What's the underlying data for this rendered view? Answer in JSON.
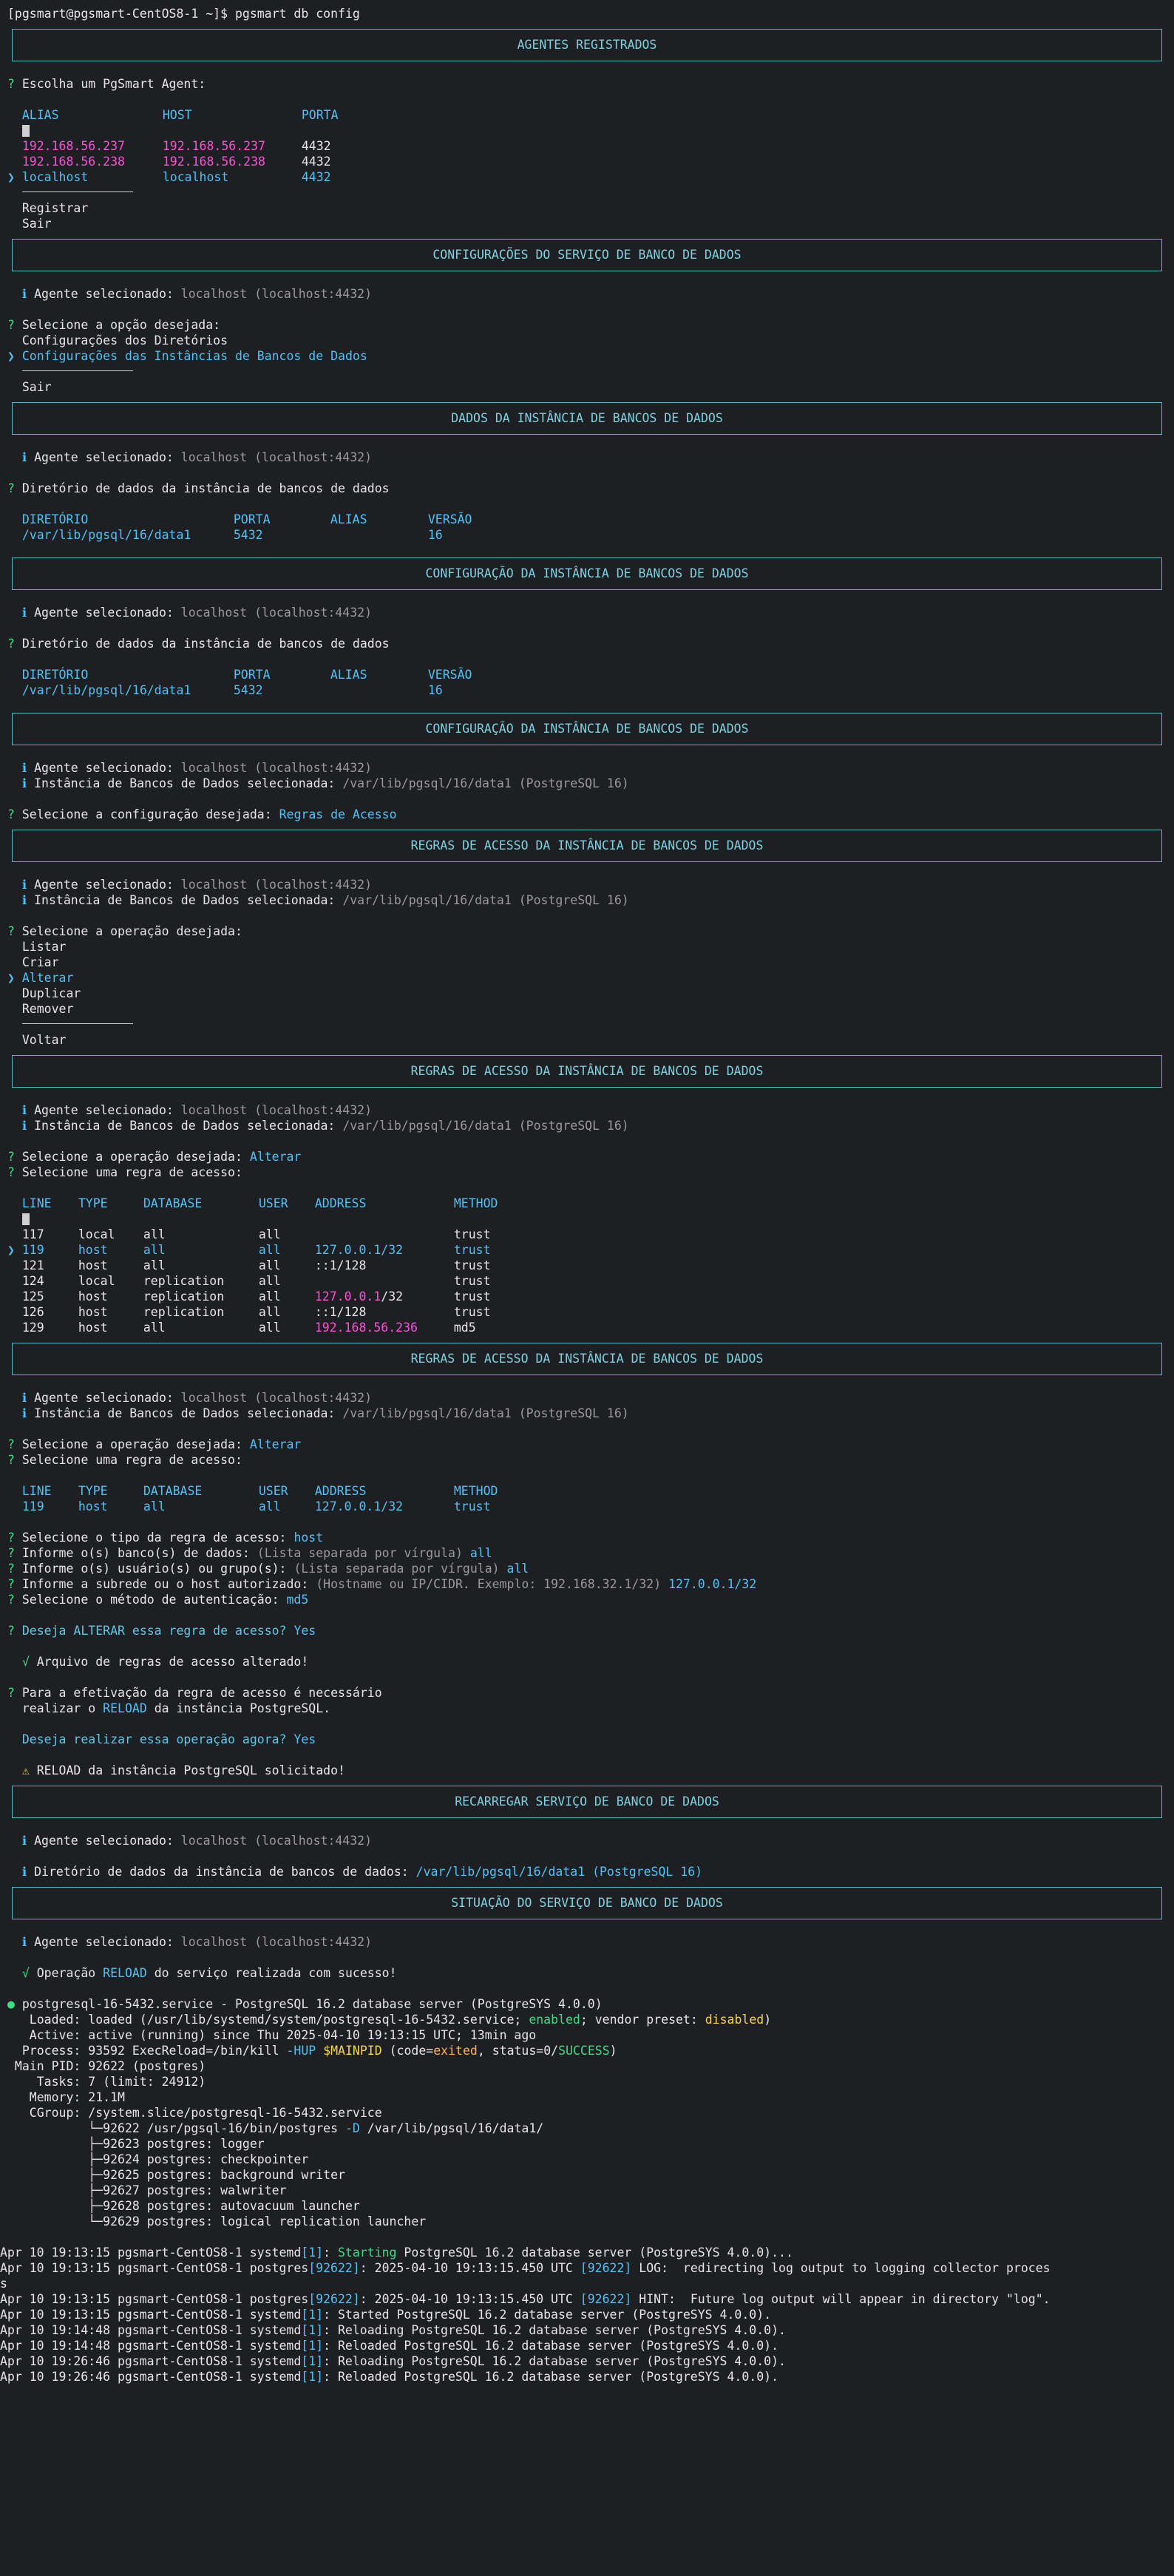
{
  "prompt": "[pgsmart@pgsmart-CentOS8-1 ~]$ pgsmart db config",
  "s1": {
    "header": "AGENTES REGISTRADOS",
    "question": "Escolha um PgSmart Agent:",
    "cols": [
      "ALIAS",
      "HOST",
      "PORTA"
    ],
    "rows": [
      {
        "alias": "192.168.56.237",
        "host": "192.168.56.237",
        "port": "4432"
      },
      {
        "alias": "192.168.56.238",
        "host": "192.168.56.238",
        "port": "4432"
      },
      {
        "alias": "localhost",
        "host": "localhost",
        "port": "4432"
      }
    ],
    "opt1": "Registrar",
    "opt2": "Sair"
  },
  "s2": {
    "header": "CONFIGURAÇÕES DO SERVIÇO DE BANCO DE DADOS",
    "agent_label": "Agente selecionado:",
    "agent_val": "localhost (localhost:4432)",
    "question": "Selecione a opção desejada:",
    "opt1": "Configurações dos Diretórios",
    "opt2": "Configurações das Instâncias de Bancos de Dados",
    "opt3": "Sair"
  },
  "s3": {
    "header": "DADOS DA INSTÂNCIA DE BANCOS DE DADOS",
    "agent_label": "Agente selecionado:",
    "agent_val": "localhost (localhost:4432)",
    "question": "Diretório de dados da instância de bancos de dados",
    "cols": [
      "DIRETÓRIO",
      "PORTA",
      "ALIAS",
      "VERSÃO"
    ],
    "row": {
      "dir": "/var/lib/pgsql/16/data1",
      "port": "5432",
      "alias": "",
      "ver": "16"
    }
  },
  "s4": {
    "header": "CONFIGURAÇÃO DA INSTÂNCIA DE BANCOS DE DADOS",
    "agent_label": "Agente selecionado:",
    "agent_val": "localhost (localhost:4432)",
    "question": "Diretório de dados da instância de bancos de dados",
    "cols": [
      "DIRETÓRIO",
      "PORTA",
      "ALIAS",
      "VERSÃO"
    ],
    "row": {
      "dir": "/var/lib/pgsql/16/data1",
      "port": "5432",
      "alias": "",
      "ver": "16"
    }
  },
  "s5": {
    "header": "CONFIGURAÇÃO DA INSTÂNCIA DE BANCOS DE DADOS",
    "agent_label": "Agente selecionado:",
    "agent_val": "localhost (localhost:4432)",
    "inst_label": "Instância de Bancos de Dados selecionada:",
    "inst_val": "/var/lib/pgsql/16/data1 (PostgreSQL 16)",
    "question": "Selecione a configuração desejada:",
    "answer": "Regras de Acesso"
  },
  "s6": {
    "header": "REGRAS DE ACESSO DA INSTÂNCIA DE BANCOS DE DADOS",
    "agent_label": "Agente selecionado:",
    "agent_val": "localhost (localhost:4432)",
    "inst_label": "Instância de Bancos de Dados selecionada:",
    "inst_val": "/var/lib/pgsql/16/data1 (PostgreSQL 16)",
    "question": "Selecione a operação desejada:",
    "ops": [
      "Listar",
      "Criar",
      "Alterar",
      "Duplicar",
      "Remover"
    ],
    "back": "Voltar"
  },
  "s7": {
    "header": "REGRAS DE ACESSO DA INSTÂNCIA DE BANCOS DE DADOS",
    "agent_label": "Agente selecionado:",
    "agent_val": "localhost (localhost:4432)",
    "inst_label": "Instância de Bancos de Dados selecionada:",
    "inst_val": "/var/lib/pgsql/16/data1 (PostgreSQL 16)",
    "q1": "Selecione a operação desejada:",
    "a1": "Alterar",
    "q2": "Selecione uma regra de acesso:",
    "cols": [
      "LINE",
      "TYPE",
      "DATABASE",
      "USER",
      "ADDRESS",
      "METHOD"
    ],
    "rows": [
      {
        "line": "117",
        "type": "local",
        "db": "all",
        "user": "all",
        "addr": "",
        "addr2": "",
        "method": "trust"
      },
      {
        "line": "119",
        "type": "host",
        "db": "all",
        "user": "all",
        "addr": "127.0.0.1/32",
        "addr2": "",
        "method": "trust"
      },
      {
        "line": "121",
        "type": "host",
        "db": "all",
        "user": "all",
        "addr": "::1/128",
        "addr2": "",
        "method": "trust"
      },
      {
        "line": "124",
        "type": "local",
        "db": "replication",
        "user": "all",
        "addr": "",
        "addr2": "",
        "method": "trust"
      },
      {
        "line": "125",
        "type": "host",
        "db": "replication",
        "user": "all",
        "addr": "127.0.0.1",
        "addr2": "/32",
        "method": "trust"
      },
      {
        "line": "126",
        "type": "host",
        "db": "replication",
        "user": "all",
        "addr": "::1/128",
        "addr2": "",
        "method": "trust"
      },
      {
        "line": "129",
        "type": "host",
        "db": "all",
        "user": "all",
        "addr": "192.168.56.236",
        "addr2": "",
        "method": "md5"
      }
    ]
  },
  "s8": {
    "header": "REGRAS DE ACESSO DA INSTÂNCIA DE BANCOS DE DADOS",
    "agent_label": "Agente selecionado:",
    "agent_val": "localhost (localhost:4432)",
    "inst_label": "Instância de Bancos de Dados selecionada:",
    "inst_val": "/var/lib/pgsql/16/data1 (PostgreSQL 16)",
    "q1": "Selecione a operação desejada:",
    "a1": "Alterar",
    "q2": "Selecione uma regra de acesso:",
    "cols": [
      "LINE",
      "TYPE",
      "DATABASE",
      "USER",
      "ADDRESS",
      "METHOD"
    ],
    "row": {
      "line": "119",
      "type": "host",
      "db": "all",
      "user": "all",
      "addr": "127.0.0.1/32",
      "method": "trust"
    },
    "q3": "Selecione o tipo da regra de acesso:",
    "a3": "host",
    "q4": "Informe o(s) banco(s) de dados:",
    "h4": "(Lista separada por vírgula)",
    "a4": "all",
    "q5": "Informe o(s) usuário(s) ou grupo(s):",
    "h5": "(Lista separada por vírgula)",
    "a5": "all",
    "q6": "Informe a subrede ou o host autorizado:",
    "h6": "(Hostname ou IP/CIDR. Exemplo: 192.168.32.1/32)",
    "a6": "127.0.0.1/32",
    "q7": "Selecione o método de autenticação:",
    "a7": "md5",
    "q8": "Deseja ALTERAR essa regra de acesso?",
    "a8": "Yes",
    "ok": "Arquivo de regras de acesso alterado!",
    "n1a": "Para a efetivação da regra de acesso é necessário",
    "n1b_pre": "realizar o ",
    "n1b_kw": "RELOAD",
    "n1b_post": " da instância PostgreSQL.",
    "q9": "Deseja realizar essa operação agora?",
    "a9": "Yes",
    "warn": "RELOAD da instância PostgreSQL solicitado!"
  },
  "s9": {
    "header": "RECARREGAR SERVIÇO DE BANCO DE DADOS",
    "agent_label": "Agente selecionado:",
    "agent_val": "localhost (localhost:4432)",
    "dir_label": "Diretório de dados da instância de bancos de dados:",
    "dir_val": "/var/lib/pgsql/16/data1 (PostgreSQL 16)"
  },
  "s10": {
    "header": "SITUAÇÃO DO SERVIÇO DE BANCO DE DADOS",
    "agent_label": "Agente selecionado:",
    "agent_val": "localhost (localhost:4432)",
    "ok_pre": "Operação ",
    "ok_kw": "RELOAD",
    "ok_post": " do serviço realizada com sucesso!"
  },
  "status": {
    "l1": "postgresql-16-5432.service - PostgreSQL 16.2 database server (PostgreSYS 4.0.0)",
    "l2_a": "   Loaded: loaded (/usr/lib/systemd/system/postgresql-16-5432.service; ",
    "l2_b": "enabled",
    "l2_c": "; vendor preset: ",
    "l2_d": "disabled",
    "l2_e": ")",
    "l3": "   Active: active (running) since Thu 2025-04-10 19:13:15 UTC; 13min ago",
    "l4_a": "  Process: 93592 ExecReload=/bin/kill ",
    "l4_b": "-HUP",
    "l4_c": " ",
    "l4_d": "$MAINPID",
    "l4_e": " (code=",
    "l4_f": "exited",
    "l4_g": ", status=0/",
    "l4_h": "SUCCESS",
    "l4_i": ")",
    "l5": " Main PID: 92622 (postgres)",
    "l6": "    Tasks: 7 (limit: 24912)",
    "l7": "   Memory: 21.1M",
    "l8": "   CGroup: /system.slice/postgresql-16-5432.service",
    "l9_a": "           └─92622 /usr/pgsql-16/bin/postgres ",
    "l9_b": "-D",
    "l9_c": " /var/lib/pgsql/16/data1/",
    "procs": [
      "           ├─92623 postgres: logger",
      "           ├─92624 postgres: checkpointer",
      "           ├─92625 postgres: background writer",
      "           ├─92627 postgres: walwriter",
      "           ├─92628 postgres: autovacuum launcher",
      "           └─92629 postgres: logical replication launcher"
    ]
  },
  "logs": [
    {
      "pre": "Apr 10 19:13:15 pgsmart-CentOS8-1 systemd",
      "pid": "[1]",
      "post": ": ",
      "hl": "Starting",
      "rest": " PostgreSQL 16.2 database server (PostgreSYS 4.0.0)..."
    },
    {
      "pre": "Apr 10 19:13:15 pgsmart-CentOS8-1 postgres",
      "pid": "[92622]",
      "post": ": 2025-04-10 19:13:15.450 UTC ",
      "hl": "[92622]",
      "rest": " LOG:  redirecting log output to logging collector proces"
    },
    {
      "pre": "s",
      "pid": "",
      "post": "",
      "hl": "",
      "rest": ""
    },
    {
      "pre": "Apr 10 19:13:15 pgsmart-CentOS8-1 postgres",
      "pid": "[92622]",
      "post": ": 2025-04-10 19:13:15.450 UTC ",
      "hl": "[92622]",
      "rest": " HINT:  Future log output will appear in directory \"log\"."
    },
    {
      "pre": "Apr 10 19:13:15 pgsmart-CentOS8-1 systemd",
      "pid": "[1]",
      "post": ": Started PostgreSQL 16.2 database server (PostgreSYS 4.0.0).",
      "hl": "",
      "rest": ""
    },
    {
      "pre": "Apr 10 19:14:48 pgsmart-CentOS8-1 systemd",
      "pid": "[1]",
      "post": ": Reloading PostgreSQL 16.2 database server (PostgreSYS 4.0.0).",
      "hl": "",
      "rest": ""
    },
    {
      "pre": "Apr 10 19:14:48 pgsmart-CentOS8-1 systemd",
      "pid": "[1]",
      "post": ": Reloaded PostgreSQL 16.2 database server (PostgreSYS 4.0.0).",
      "hl": "",
      "rest": ""
    },
    {
      "pre": "Apr 10 19:26:46 pgsmart-CentOS8-1 systemd",
      "pid": "[1]",
      "post": ": Reloading PostgreSQL 16.2 database server (PostgreSYS 4.0.0).",
      "hl": "",
      "rest": ""
    },
    {
      "pre": "Apr 10 19:26:46 pgsmart-CentOS8-1 systemd",
      "pid": "[1]",
      "post": ": Reloaded PostgreSQL 16.2 database server (PostgreSYS 4.0.0).",
      "hl": "",
      "rest": ""
    }
  ]
}
